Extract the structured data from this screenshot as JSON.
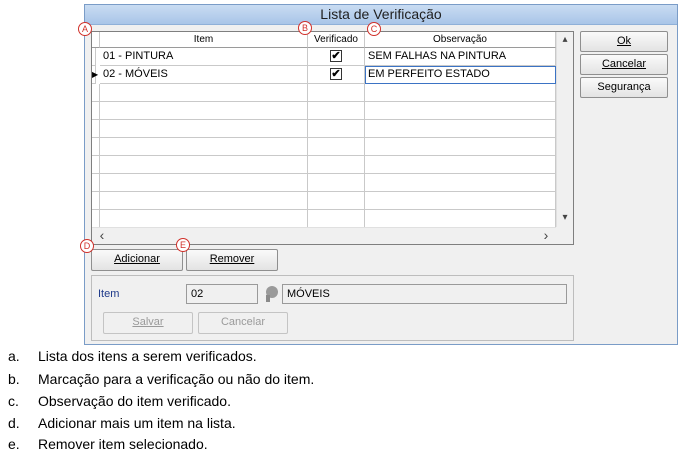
{
  "window": {
    "title": "Lista de Verificação"
  },
  "grid": {
    "columns": [
      "Item",
      "Verificado",
      "Observação"
    ],
    "rows": [
      {
        "item": "01 - PINTURA",
        "checked": "✔",
        "observation": "SEM FALHAS NA PINTURA"
      },
      {
        "item": "02 - MÓVEIS",
        "checked": "✔",
        "observation": "EM PERFEITO ESTADO",
        "selected": true
      }
    ],
    "current_row_indicator": "▶",
    "scroll_up": "▴",
    "scroll_down": "▾",
    "scroll_left": "‹",
    "scroll_right": "›"
  },
  "side_buttons": {
    "ok": "Ok",
    "cancel": "Cancelar",
    "security": "Segurança"
  },
  "grid_buttons": {
    "add": "Adicionar",
    "remove": "Remover"
  },
  "edit_panel": {
    "label": "Item",
    "code": "02",
    "description": "MÓVEIS",
    "save": "Salvar",
    "cancel": "Cancelar"
  },
  "markers": {
    "a": "A",
    "b": "B",
    "c": "C",
    "d": "D",
    "e": "E"
  },
  "legend": [
    {
      "letter": "a.",
      "text": "Lista dos itens a serem verificados."
    },
    {
      "letter": "b.",
      "text": "Marcação para a verificação ou não do item."
    },
    {
      "letter": "c.",
      "text": "Observação do item verificado."
    },
    {
      "letter": "d.",
      "text": "Adicionar mais um item na lista."
    },
    {
      "letter": "e.",
      "text": "Remover item selecionado."
    }
  ],
  "colors": {
    "marker": "#d0302a",
    "title_bar": "#b8d0ee",
    "label_blue": "#1f3a8a"
  }
}
